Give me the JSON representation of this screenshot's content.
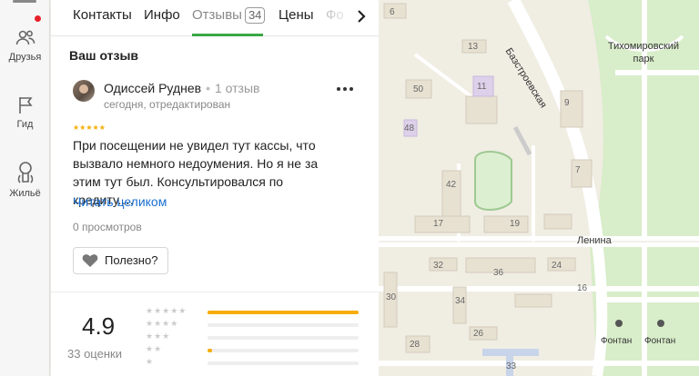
{
  "rail": {
    "items": [
      {
        "label": "Друзья",
        "icon": "friends-icon"
      },
      {
        "label": "Гид",
        "icon": "guide-flag-icon"
      },
      {
        "label": "Жильё",
        "icon": "housing-icon"
      }
    ],
    "notification_color": "#e8202a"
  },
  "tabs": {
    "items": [
      "Контакты",
      "Инфо",
      "Отзывы",
      "Цены",
      "Фо"
    ],
    "active": "Отзывы",
    "reviews_count": "34",
    "accent": "#3aa845"
  },
  "review": {
    "section_title": "Ваш отзыв",
    "author": "Одиссей Руднев",
    "author_reviews": "1 отзыв",
    "date": "сегодня, отредактирован",
    "stars": "★★★★★",
    "rating": 5,
    "text": "При посещении не увидел тут кассы, что вызвало немного недоумения. Но я не за этим тут был. Консультировался по кредиту.…",
    "read_more": "Читать целиком",
    "views": "0 просмотров",
    "useful_label": "Полезно?"
  },
  "rating_summary": {
    "value": "4.9",
    "count": "33 оценки",
    "distribution": [
      {
        "stars": 5,
        "fraction": 1.0
      },
      {
        "stars": 4,
        "fraction": 0.0
      },
      {
        "stars": 3,
        "fraction": 0.0
      },
      {
        "stars": 2,
        "fraction": 0.03
      },
      {
        "stars": 1,
        "fraction": 0.0
      }
    ],
    "bar_color": "#f6ad07"
  },
  "map": {
    "streets": [
      "Базстроевская",
      "Ленина"
    ],
    "park": "Тихомировский парк",
    "fountains": [
      "Фонтан",
      "Фонтан"
    ],
    "house_numbers": [
      "6",
      "13",
      "11",
      "50",
      "48",
      "42",
      "17",
      "19",
      "32",
      "36",
      "34",
      "30",
      "28",
      "26",
      "24",
      "33",
      "16",
      "9",
      "7"
    ]
  }
}
